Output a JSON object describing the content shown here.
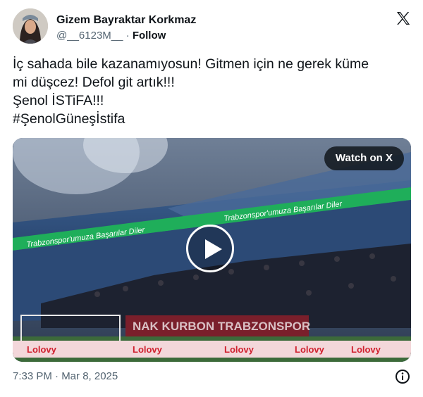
{
  "author": {
    "display_name": "Gizem Bayraktar Korkmaz",
    "handle": "@__6123M__",
    "separator": "·",
    "follow_label": "Follow",
    "avatar_icon": "avatar-photo"
  },
  "tweet": {
    "lines": [
      "İç sahada bile kazanamıyosun! Gitmen için ne gerek küme",
      "mi düşcez! Defol git artık!!!",
      "Şenol İSTiFA!!!",
      "#ŞenolGüneşİstifa"
    ]
  },
  "media": {
    "watch_label": "Watch on X",
    "led_banner_text": "Trabzonspor'umuza Başarılar Diler",
    "stand_banner_text": "NAK KURBON TRABZONSPOR",
    "ad_board_text": "Lolovy"
  },
  "footer": {
    "timestamp": "7:33 PM · Mar 8, 2025"
  },
  "colors": {
    "text": "#0f1419",
    "muted": "#536471",
    "led_green": "#1fae5a",
    "banner_maroon": "#7a1f2b",
    "ad_red": "#d0202e"
  }
}
